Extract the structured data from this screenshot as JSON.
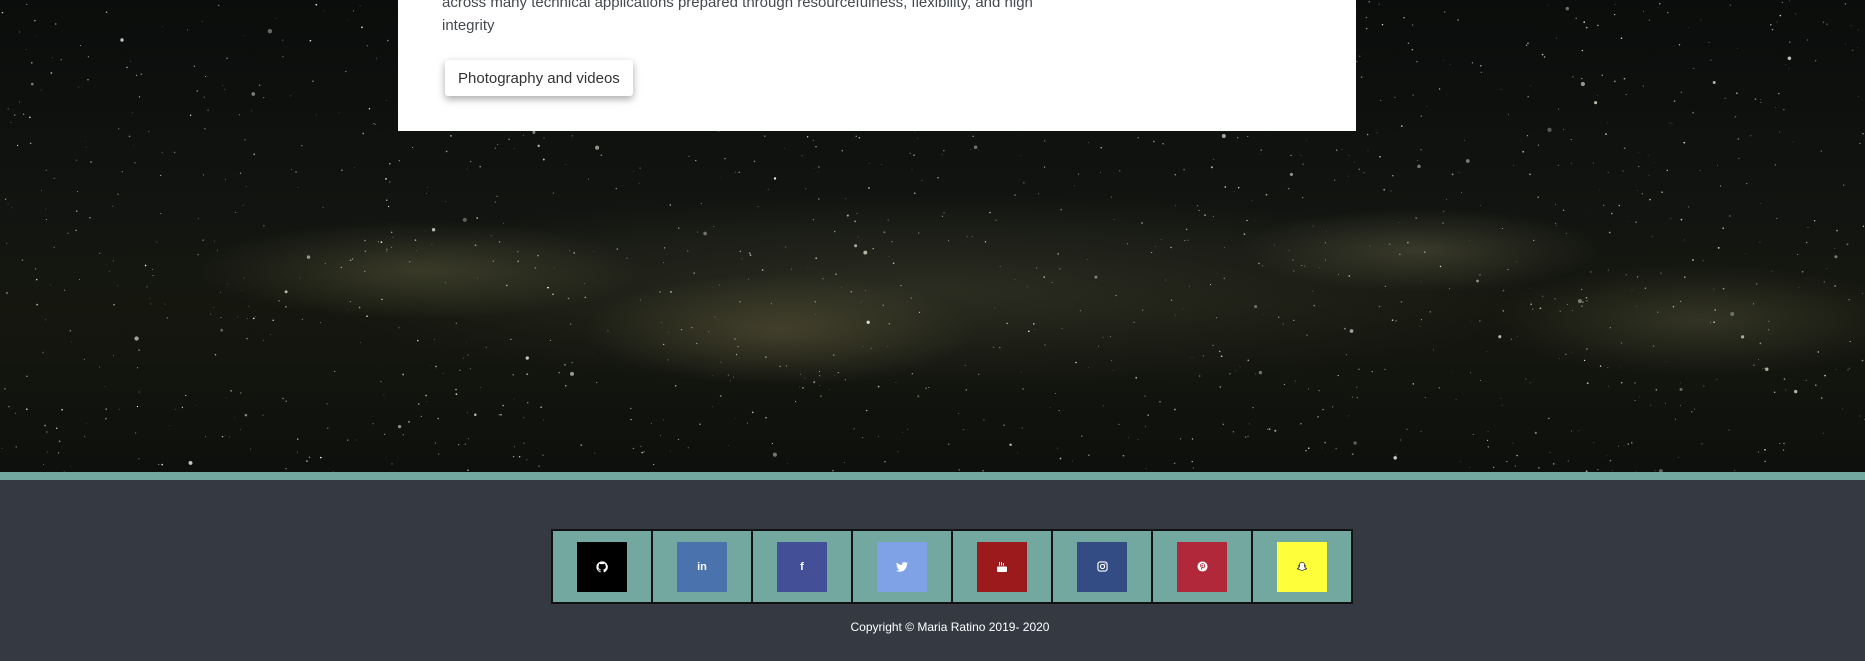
{
  "card": {
    "text_line1": "across many technical applications prepared through resourcefulness, flexibility, and high",
    "text_line2": "integrity",
    "button_label": "Photography and videos"
  },
  "footer": {
    "social_links": [
      {
        "icon": "github-icon",
        "color": "#000000"
      },
      {
        "icon": "linkedin-icon",
        "label": "in",
        "color": "#4a73ad"
      },
      {
        "icon": "facebook-icon",
        "label": "f",
        "color": "#434f96"
      },
      {
        "icon": "twitter-icon",
        "color": "#7fa2e6"
      },
      {
        "icon": "youtube-icon",
        "color": "#9c1a1c"
      },
      {
        "icon": "instagram-icon",
        "color": "#344c84"
      },
      {
        "icon": "pinterest-icon",
        "color": "#b0283a"
      },
      {
        "icon": "snapchat-icon",
        "color": "#fefe3a"
      }
    ],
    "copyright": "Copyright © Maria Ratino 2019- 2020"
  },
  "colors": {
    "accent": "#72a8a0",
    "footer_bg": "#353a42",
    "card_bg": "#ffffff"
  }
}
